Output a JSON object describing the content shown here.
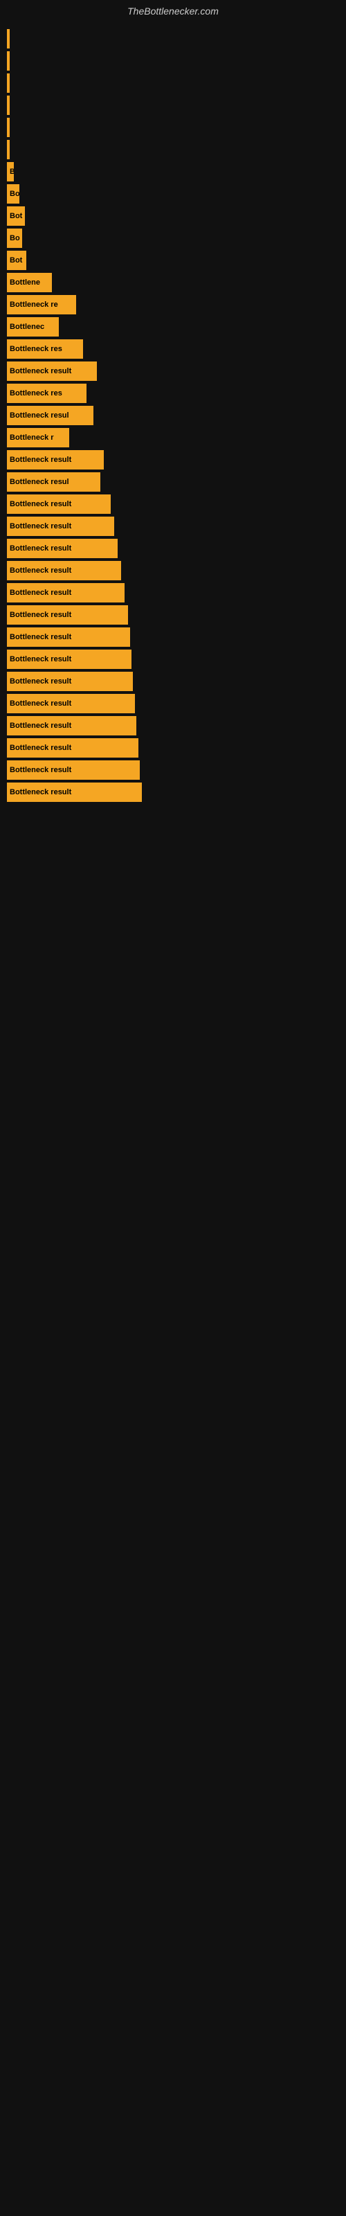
{
  "site": {
    "title": "TheBottlenecker.com"
  },
  "bars": [
    {
      "label": "",
      "width": 2
    },
    {
      "label": "",
      "width": 2
    },
    {
      "label": "",
      "width": 3
    },
    {
      "label": "",
      "width": 2
    },
    {
      "label": "",
      "width": 2
    },
    {
      "label": "",
      "width": 3
    },
    {
      "label": "B",
      "width": 10
    },
    {
      "label": "Bo",
      "width": 18
    },
    {
      "label": "Bot",
      "width": 26
    },
    {
      "label": "Bo",
      "width": 22
    },
    {
      "label": "Bot",
      "width": 28
    },
    {
      "label": "Bottlene",
      "width": 65
    },
    {
      "label": "Bottleneck re",
      "width": 100
    },
    {
      "label": "Bottlenec",
      "width": 75
    },
    {
      "label": "Bottleneck res",
      "width": 110
    },
    {
      "label": "Bottleneck result",
      "width": 130
    },
    {
      "label": "Bottleneck res",
      "width": 115
    },
    {
      "label": "Bottleneck resul",
      "width": 125
    },
    {
      "label": "Bottleneck r",
      "width": 90
    },
    {
      "label": "Bottleneck result",
      "width": 140
    },
    {
      "label": "Bottleneck resul",
      "width": 135
    },
    {
      "label": "Bottleneck result",
      "width": 150
    },
    {
      "label": "Bottleneck result",
      "width": 155
    },
    {
      "label": "Bottleneck result",
      "width": 160
    },
    {
      "label": "Bottleneck result",
      "width": 165
    },
    {
      "label": "Bottleneck result",
      "width": 170
    },
    {
      "label": "Bottleneck result",
      "width": 175
    },
    {
      "label": "Bottleneck result",
      "width": 178
    },
    {
      "label": "Bottleneck result",
      "width": 180
    },
    {
      "label": "Bottleneck result",
      "width": 182
    },
    {
      "label": "Bottleneck result",
      "width": 185
    },
    {
      "label": "Bottleneck result",
      "width": 187
    },
    {
      "label": "Bottleneck result",
      "width": 190
    },
    {
      "label": "Bottleneck result",
      "width": 192
    },
    {
      "label": "Bottleneck result",
      "width": 195
    }
  ]
}
